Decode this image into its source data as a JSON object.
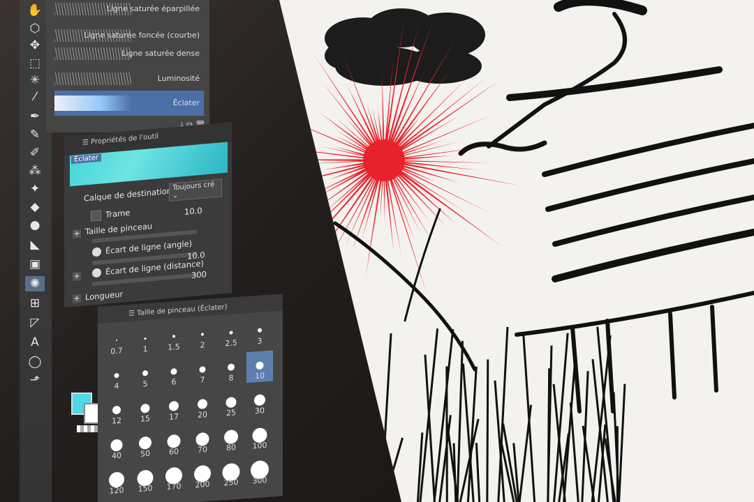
{
  "brush_list": {
    "items": [
      {
        "label": "Ligne saturée éparpillée"
      },
      {
        "label": "Ligne saturée foncée (courbe)"
      },
      {
        "label": "Ligne saturée dense"
      },
      {
        "label": "Luminosité"
      },
      {
        "label": "Éclater"
      }
    ],
    "selected_index": 4
  },
  "tool_props": {
    "tab_title": "Propriétés de l'outil",
    "preview_label": "Éclater",
    "dest_label": "Calque de destination",
    "dest_value": "Toujours cré",
    "trame_label": "Trame",
    "brush_size_label": "Taille de pinceau",
    "brush_size_value": "10.0",
    "angle_label": "Écart de ligne (angle)",
    "distance_label": "Écart de ligne (distance)",
    "distance_value": "10.0",
    "length_label": "Longueur",
    "length_value": "300"
  },
  "size_panel": {
    "tab_title": "Taille de pinceau (Éclater)",
    "sizes": [
      "0.7",
      "1",
      "1.5",
      "2",
      "2.5",
      "3",
      "4",
      "5",
      "6",
      "7",
      "8",
      "10",
      "12",
      "15",
      "17",
      "20",
      "25",
      "30",
      "40",
      "50",
      "60",
      "70",
      "80",
      "100",
      "120",
      "150",
      "170",
      "200",
      "250",
      "300"
    ],
    "selected": "10"
  },
  "colors": {
    "main": "#4fd9e6",
    "sub": "#ffffff",
    "accent": "#4d6fa8",
    "burst": "#e8222c"
  },
  "icons": [
    "hand-icon",
    "rotate-icon",
    "move-icon",
    "selection-icon",
    "magic-wand-icon",
    "eyedropper-icon",
    "pen-icon",
    "pencil-icon",
    "brush-icon",
    "airbrush-icon",
    "decorate-icon",
    "eraser-icon",
    "blend-icon",
    "fill-icon",
    "gradient-icon",
    "saturated-line-icon",
    "frame-icon",
    "ruler-icon",
    "text-icon",
    "balloon-icon",
    "correct-line-icon"
  ]
}
